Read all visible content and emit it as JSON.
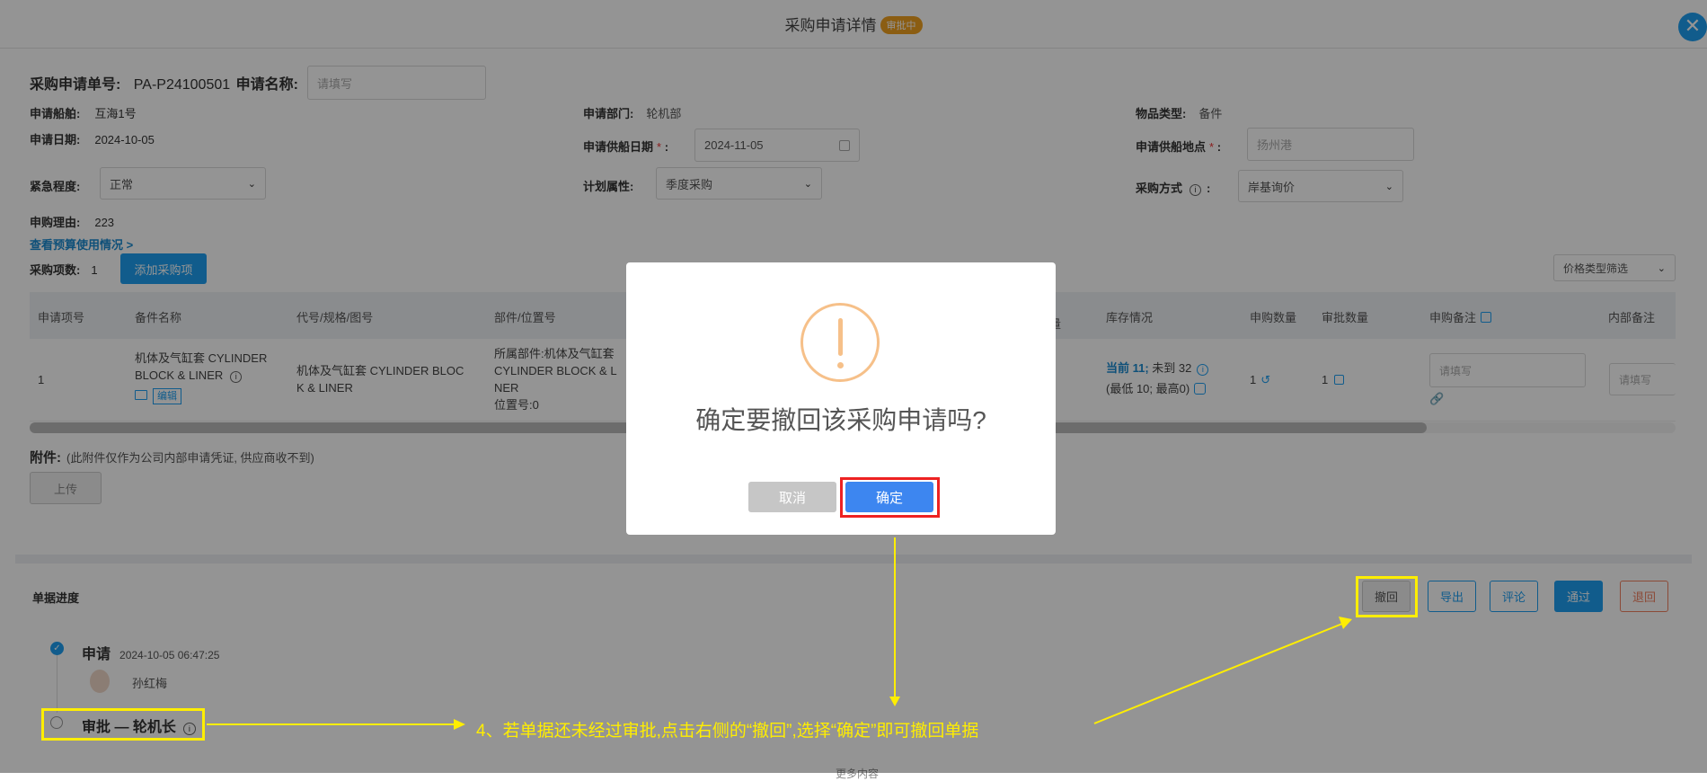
{
  "header": {
    "title": "采购申请详情",
    "status_badge": "审批中",
    "close_icon": "close-icon"
  },
  "form": {
    "req_no_label": "采购申请单号:",
    "req_no_value": "PA-P24100501",
    "req_name_label": "申请名称:",
    "req_name_placeholder": "请填写",
    "ship_label": "申请船舶:",
    "ship_value": "互海1号",
    "dept_label": "申请部门:",
    "dept_value": "轮机部",
    "item_type_label": "物品类型:",
    "item_type_value": "备件",
    "date_label": "申请日期:",
    "date_value": "2024-10-05",
    "supply_date_label": "申请供船日期",
    "supply_date_value": "2024-11-05",
    "supply_place_label": "申请供船地点",
    "supply_place_value": "扬州港",
    "urgency_label": "紧急程度:",
    "urgency_value": "正常",
    "plan_label": "计划属性:",
    "plan_value": "季度采购",
    "method_label": "采购方式",
    "method_value": "岸基询价",
    "reason_label": "申购理由:",
    "reason_value": "223",
    "budget_link": "查看预算使用情况 >",
    "count_label": "采购项数:",
    "count_value": "1",
    "add_item_button": "添加采购项",
    "price_filter": "价格类型筛选",
    "required_mark": "*"
  },
  "table": {
    "headers": [
      "申请项号",
      "备件名称",
      "代号/规格/图号",
      "部件/位置号",
      "库存情况",
      "申购数量",
      "审批数量",
      "申购备注",
      "内部备注"
    ],
    "partial_header": "量",
    "row": {
      "no": "1",
      "name_lines": [
        "机体及气缸套 CYLINDER",
        "BLOCK & LINER"
      ],
      "edit_tag": "编辑",
      "spec_lines": [
        "机体及气缸套 CYLINDER BLOC",
        "K & LINER"
      ],
      "part_lines": [
        "所属部件:机体及气缸套",
        "CYLINDER BLOCK & L",
        "NER",
        "位置号:0"
      ],
      "stock_current": "当前 11;",
      "stock_arrive": " 未到 32",
      "stock_minmax": "(最低 10; 最高0)",
      "apply_qty": "1",
      "approve_qty": "1",
      "remark_placeholder": "请填写",
      "internal_placeholder": "请填写"
    }
  },
  "attachment": {
    "label": "附件:",
    "note": "(此附件仅作为公司内部申请凭证, 供应商收不到)",
    "upload_button": "上传"
  },
  "progress": {
    "title": "单据进度",
    "buttons": {
      "withdraw": "撤回",
      "export": "导出",
      "comment": "评论",
      "approve": "通过",
      "reject": "退回"
    },
    "steps": [
      {
        "name": "申请",
        "time": "2024-10-05 06:47:25",
        "user": "孙红梅"
      },
      {
        "name": "审批 — 轮机长"
      }
    ],
    "cut_text": "更多内容"
  },
  "modal": {
    "message": "确定要撤回该采购申请吗?",
    "cancel": "取消",
    "confirm": "确定"
  },
  "annotation": {
    "text": "4、若单据还未经过审批,点击右侧的“撤回”,选择“确定”即可撤回单据",
    "color": "#ffee00"
  },
  "colors": {
    "accent": "#1e9ff2",
    "warning": "#f0a020",
    "annotation": "#ffee00"
  }
}
